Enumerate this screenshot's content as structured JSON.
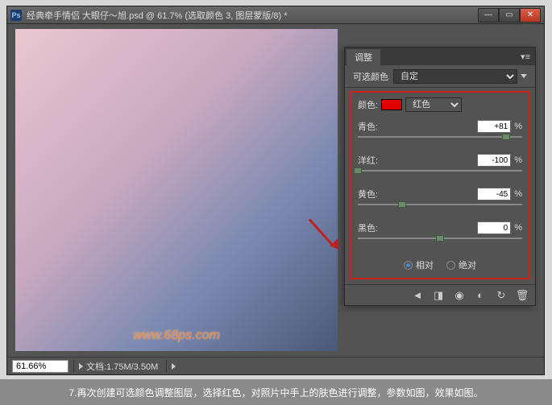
{
  "titlebar": {
    "ps": "Ps",
    "title": "经典牵手情侣     大眼仔～旭.psd @ 61.7% (选取颜色 3, 图层蒙版/8) *"
  },
  "panel": {
    "tab": "调整",
    "preset_label": "可选颜色",
    "preset_value": "自定",
    "color_label": "颜色:",
    "color_value": "红色",
    "sliders": {
      "cyan": {
        "label": "青色:",
        "value": "+81",
        "pct": "%",
        "pos": 90
      },
      "magenta": {
        "label": "洋红:",
        "value": "-100",
        "pct": "%",
        "pos": 0
      },
      "yellow": {
        "label": "黄色:",
        "value": "-45",
        "pct": "%",
        "pos": 27
      },
      "black": {
        "label": "黑色:",
        "value": "0",
        "pct": "%",
        "pos": 50
      }
    },
    "mode": {
      "relative": "相对",
      "absolute": "绝对"
    }
  },
  "statusbar": {
    "zoom": "61.66%",
    "doc": "文档:1.75M/3.50M"
  },
  "watermark": "www.68ps.com",
  "caption": "7.再次创建可选颜色调整图层，选择红色，对照片中手上的肤色进行调整，参数如图，效果如图。"
}
